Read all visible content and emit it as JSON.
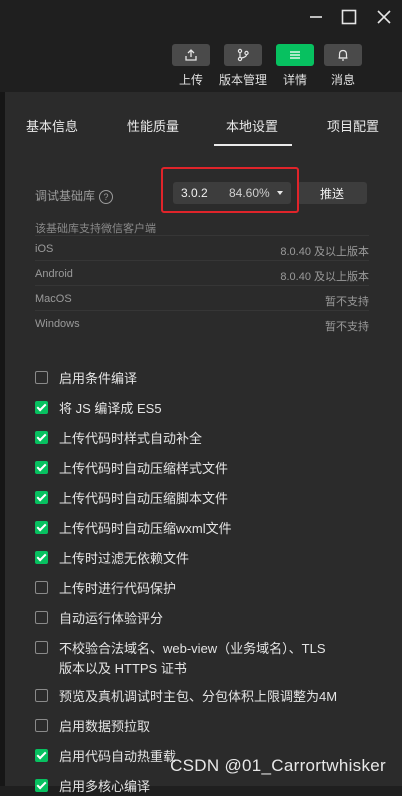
{
  "toolbar": {
    "items": [
      {
        "label": "上传",
        "icon": "upload-icon"
      },
      {
        "label": "版本管理",
        "icon": "branch-icon"
      },
      {
        "label": "详情",
        "icon": "menu-icon"
      },
      {
        "label": "消息",
        "icon": "bell-icon"
      }
    ]
  },
  "tabs": [
    "基本信息",
    "性能质量",
    "本地设置",
    "项目配置"
  ],
  "debug": {
    "label": "调试基础库",
    "help": "?",
    "version": "3.0.2",
    "percent": "84.60%",
    "push_label": "推送",
    "support_note": "该基础库支持微信客户端"
  },
  "platforms": [
    {
      "name": "iOS",
      "value": "8.0.40 及以上版本"
    },
    {
      "name": "Android",
      "value": "8.0.40 及以上版本"
    },
    {
      "name": "MacOS",
      "value": "暂不支持"
    },
    {
      "name": "Windows",
      "value": "暂不支持"
    }
  ],
  "options": [
    {
      "label": "启用条件编译",
      "checked": false
    },
    {
      "label": "将 JS 编译成 ES5",
      "checked": true
    },
    {
      "label": "上传代码时样式自动补全",
      "checked": true
    },
    {
      "label": "上传代码时自动压缩样式文件",
      "checked": true
    },
    {
      "label": "上传代码时自动压缩脚本文件",
      "checked": true
    },
    {
      "label": "上传代码时自动压缩wxml文件",
      "checked": true
    },
    {
      "label": "上传时过滤无依赖文件",
      "checked": true
    },
    {
      "label": "上传时进行代码保护",
      "checked": false
    },
    {
      "label": "自动运行体验评分",
      "checked": false
    },
    {
      "label": "不校验合法域名、web-view（业务域名）、TLS",
      "label2": "版本以及 HTTPS 证书",
      "checked": false
    },
    {
      "label": "预览及真机调试时主包、分包体积上限调整为4M",
      "checked": false
    },
    {
      "label": "启用数据预拉取",
      "checked": false
    },
    {
      "label": "启用代码自动热重载",
      "checked": true
    },
    {
      "label": "启用多核心编译",
      "checked": true
    }
  ],
  "watermark": "CSDN @01_Carrortwhisker",
  "colors": {
    "accent": "#07c160",
    "highlight": "#e0242a"
  }
}
